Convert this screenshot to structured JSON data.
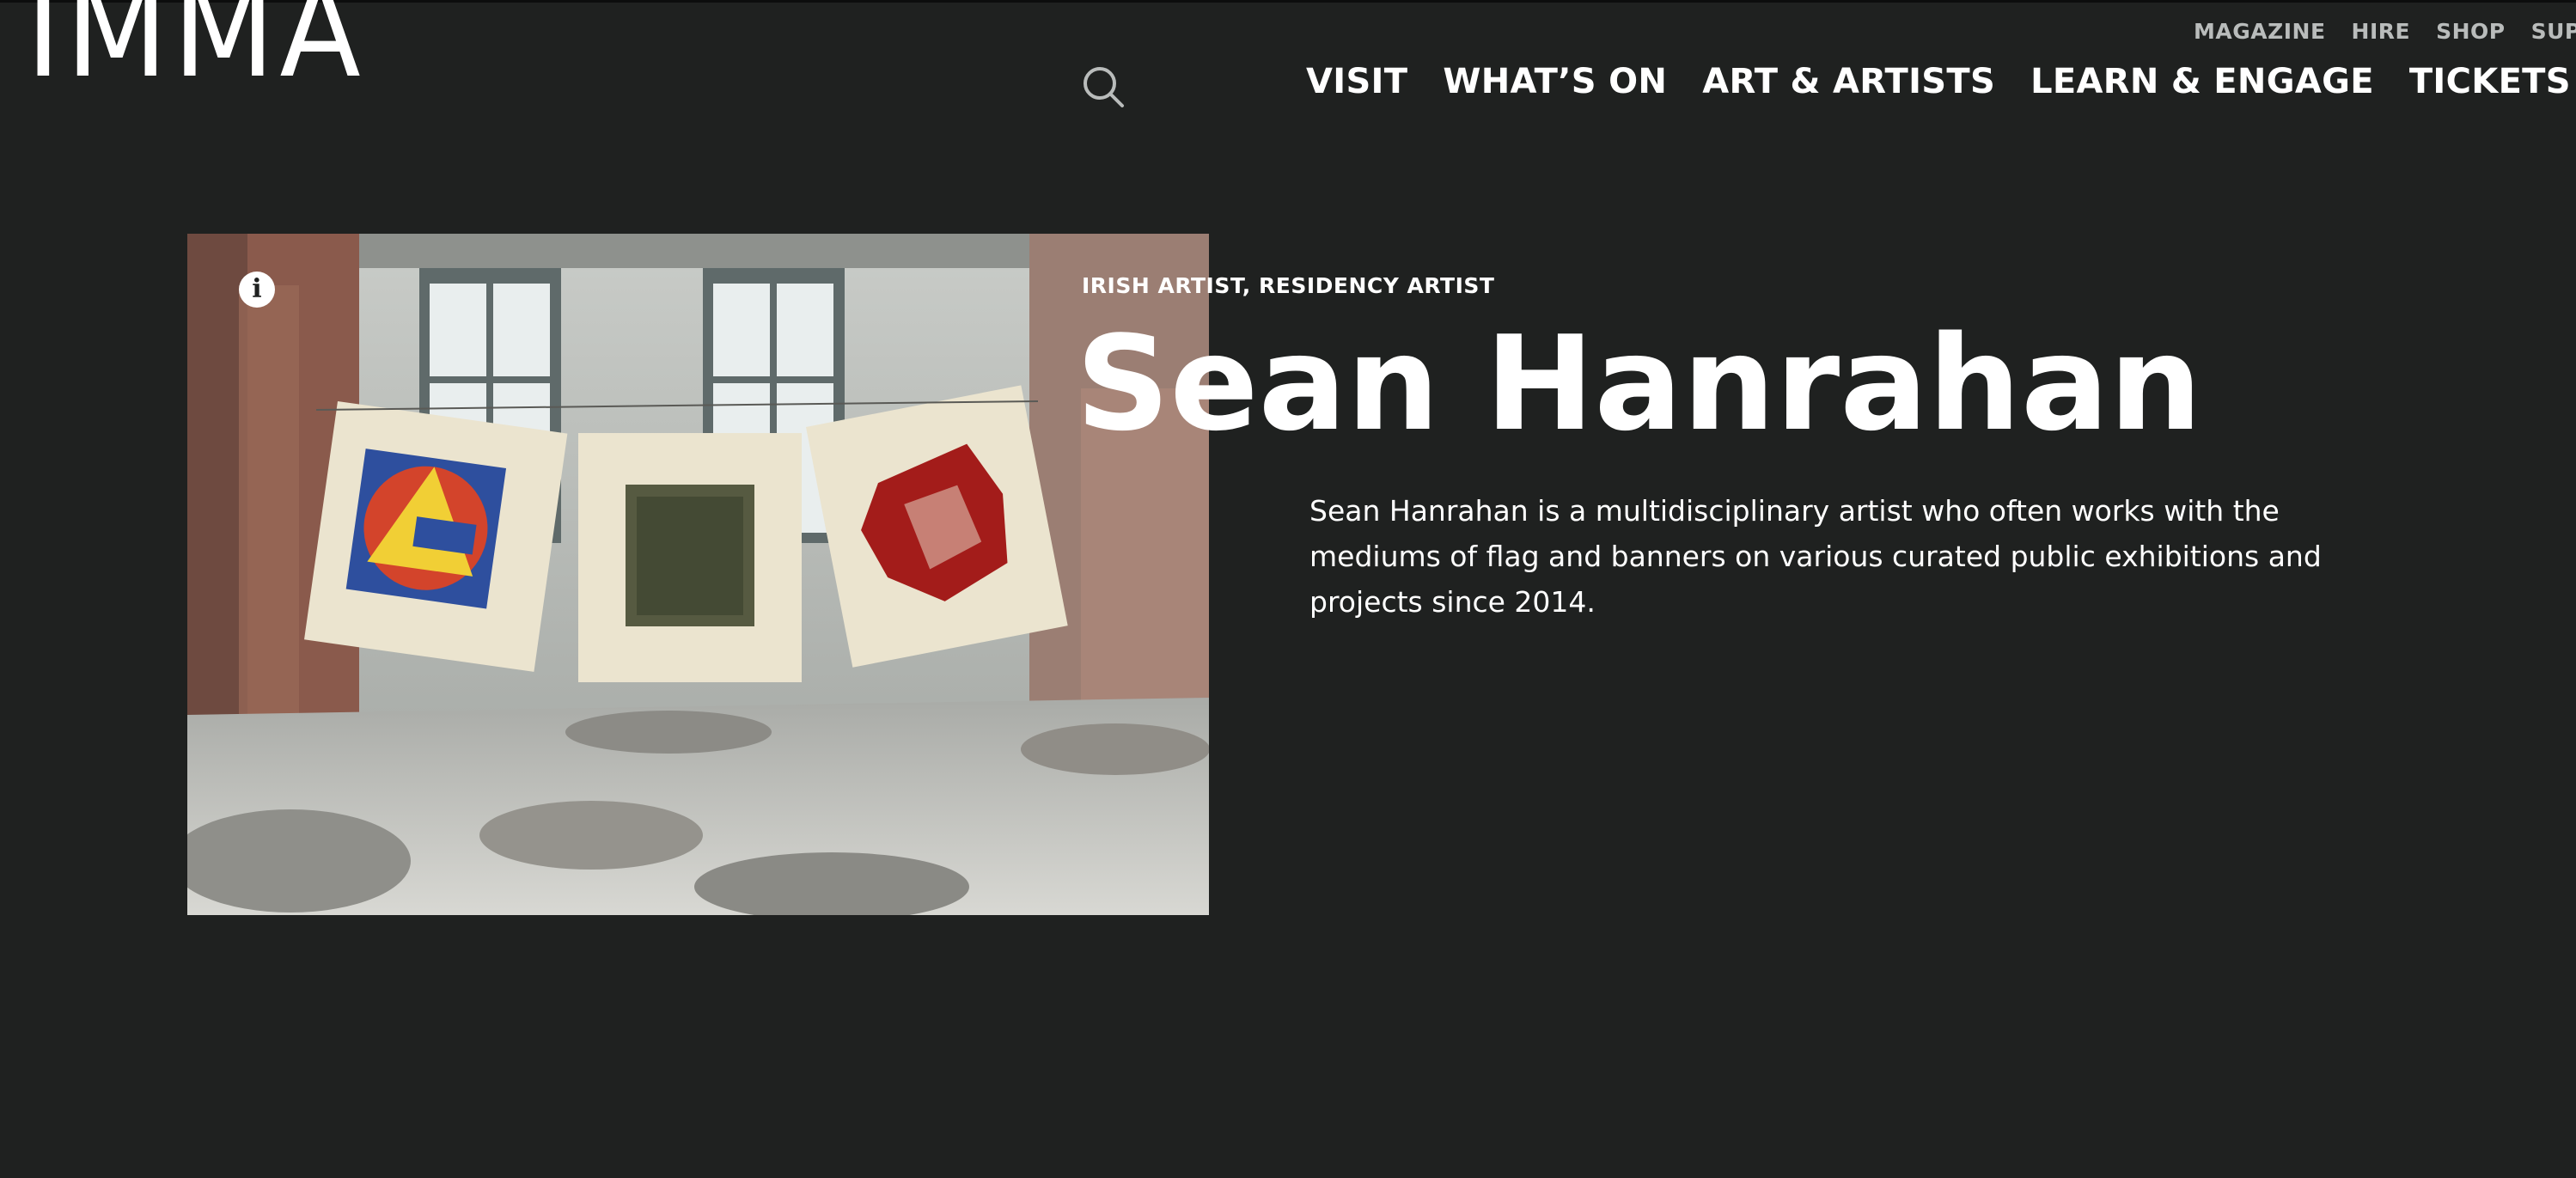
{
  "header": {
    "logo": "IMMA",
    "utility_nav": [
      "MAGAZINE",
      "HIRE",
      "SHOP",
      "SUPPORT"
    ],
    "main_nav": [
      "VISIT",
      "WHAT’S ON",
      "ART & ARTISTS",
      "LEARN & ENGAGE",
      "TICKETS"
    ]
  },
  "artist": {
    "category": "IRISH ARTIST, RESIDENCY ARTIST",
    "name": "Sean Hanrahan",
    "description": "Sean Hanrahan is a multidisciplinary artist who often works with the mediums of flag and banners on various curated public exhibitions and projects since 2014."
  },
  "colors": {
    "background": "#1f2120",
    "text": "#ffffff",
    "utility_text": "#b9bcbb"
  },
  "icons": {
    "search": "search-icon",
    "info": "info-icon"
  }
}
